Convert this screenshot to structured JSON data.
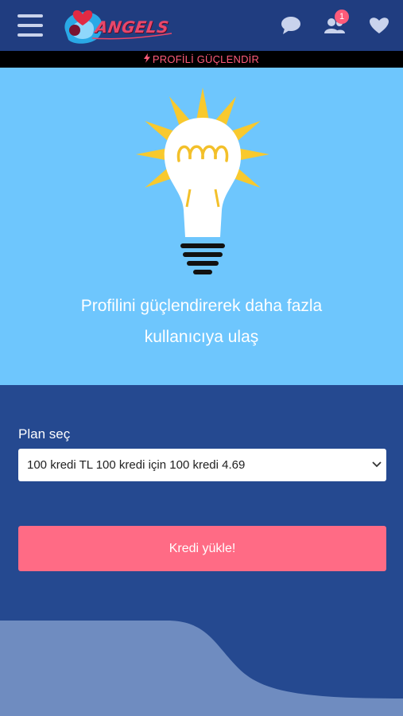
{
  "header": {
    "logo_text": "ANGELS",
    "notification_count": "1",
    "icons": [
      "menu-icon",
      "chat-icon",
      "users-icon",
      "heart-icon"
    ]
  },
  "promo_bar": {
    "label": "PROFİLİ GÜÇLENDİR"
  },
  "hero": {
    "line1": "Profilini güçlendirerek daha fazla",
    "line2": "kullanıcıya ulaş"
  },
  "form": {
    "plan_label": "Plan seç",
    "plan_selected": "100 kredi TL 100 kredi için 100 kredi 4.69",
    "submit_label": "Kredi yükle!"
  },
  "colors": {
    "header_bg": "#203d80",
    "hero_bg": "#6ec6fd",
    "body_bg": "#254990",
    "accent": "#ff6b85",
    "bulb_rays": "#f8c92e"
  }
}
